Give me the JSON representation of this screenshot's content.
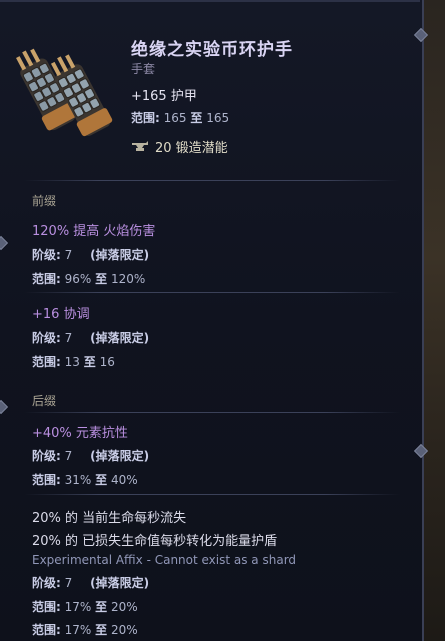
{
  "item": {
    "name": "绝缘之实验币环护手",
    "type": "手套",
    "armor": "+165 护甲",
    "armor_range": {
      "label": "范围:",
      "min": "165",
      "sep": "至",
      "max": "165"
    },
    "forging": "20 锻造潜能",
    "icon": "gauntlets-icon"
  },
  "prefix_label": "前缀",
  "suffix_label": "后缀",
  "prefixes": [
    {
      "name": "120% 提高 火焰伤害",
      "tier_label": "阶级:",
      "tier": "7",
      "tag": "(掉落限定)",
      "range_label": "范围:",
      "min": "96%",
      "sep": "至",
      "max": "120%"
    },
    {
      "name": "+16 协调",
      "tier_label": "阶级:",
      "tier": "7",
      "tag": "(掉落限定)",
      "range_label": "范围:",
      "min": "13",
      "sep": "至",
      "max": "16"
    }
  ],
  "suffixes": [
    {
      "name": "+40% 元素抗性",
      "tier_label": "阶级:",
      "tier": "7",
      "tag": "(掉落限定)",
      "range_label": "范围:",
      "min": "31%",
      "sep": "至",
      "max": "40%"
    }
  ],
  "experimental": {
    "line1": "20% 的 当前生命每秒流失",
    "line2": "20% 的 已损失生命值每秒转化为能量护盾",
    "note": "Experimental Affix - Cannot exist as a shard",
    "tier_label": "阶级:",
    "tier": "7",
    "tag": "(掉落限定)",
    "ranges": [
      {
        "label": "范围:",
        "min": "17%",
        "sep": "至",
        "max": "20%"
      },
      {
        "label": "范围:",
        "min": "17%",
        "sep": "至",
        "max": "20%"
      }
    ]
  },
  "colors": {
    "prefix_affix": "#b98fe0",
    "title": "#d9d4f3",
    "panel": "#121624"
  }
}
